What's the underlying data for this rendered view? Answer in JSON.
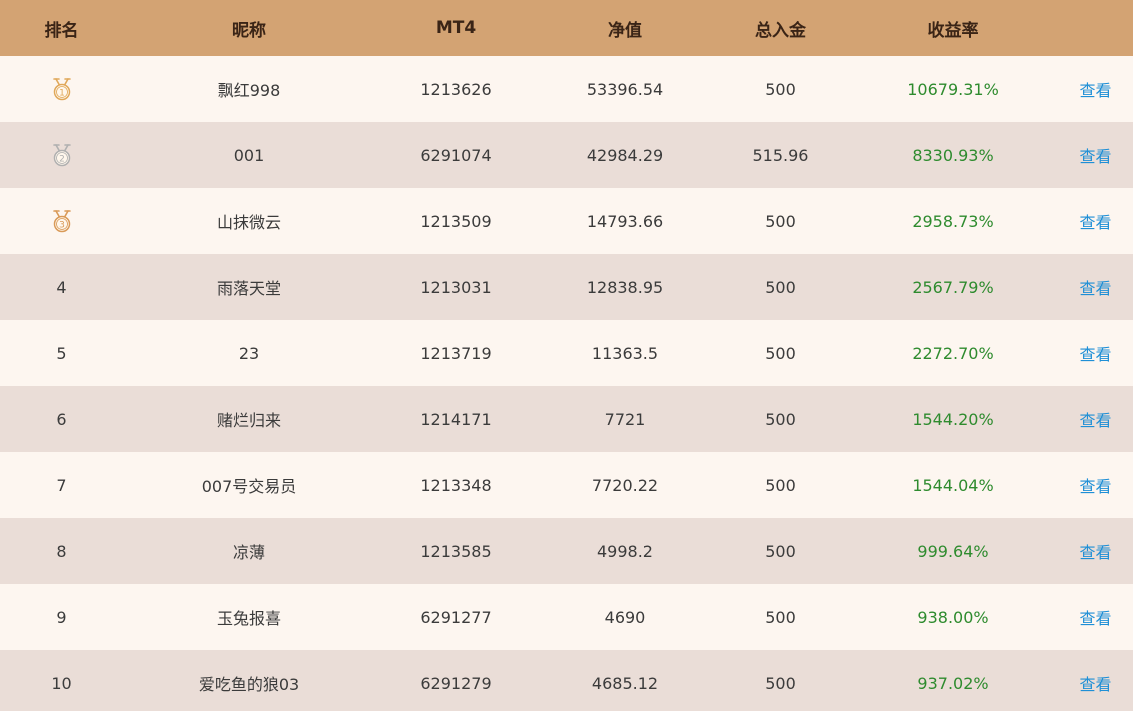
{
  "header": {
    "rank": "排名",
    "nickname": "昵称",
    "mt4": "MT4",
    "net_value": "净值",
    "total_deposit": "总入金",
    "return_rate": "收益率"
  },
  "colors": {
    "header_bg": "#d3a373",
    "row_light": "#fdf6f0",
    "row_dark": "#eaddd7",
    "rate_green": "#2e8b2e",
    "link_blue": "#1f8fd6",
    "gold_medal": "#e0a85a",
    "silver_medal": "#b0b0b0",
    "bronze_medal": "#d99a58"
  },
  "rows": [
    {
      "rank": "1",
      "medal": "gold-medal-icon",
      "nickname": "飘红998",
      "mt4": "1213626",
      "net_value": "53396.54",
      "total_deposit": "500",
      "return_rate": "10679.31%",
      "view": "查看"
    },
    {
      "rank": "2",
      "medal": "silver-medal-icon",
      "nickname": "001",
      "mt4": "6291074",
      "net_value": "42984.29",
      "total_deposit": "515.96",
      "return_rate": "8330.93%",
      "view": "查看"
    },
    {
      "rank": "3",
      "medal": "bronze-medal-icon",
      "nickname": "山抹微云",
      "mt4": "1213509",
      "net_value": "14793.66",
      "total_deposit": "500",
      "return_rate": "2958.73%",
      "view": "查看"
    },
    {
      "rank": "4",
      "nickname": "雨落天堂",
      "mt4": "1213031",
      "net_value": "12838.95",
      "total_deposit": "500",
      "return_rate": "2567.79%",
      "view": "查看"
    },
    {
      "rank": "5",
      "nickname": "23",
      "mt4": "1213719",
      "net_value": "11363.5",
      "total_deposit": "500",
      "return_rate": "2272.70%",
      "view": "查看"
    },
    {
      "rank": "6",
      "nickname": "赌烂归来",
      "mt4": "1214171",
      "net_value": "7721",
      "total_deposit": "500",
      "return_rate": "1544.20%",
      "view": "查看"
    },
    {
      "rank": "7",
      "nickname": "007号交易员",
      "mt4": "1213348",
      "net_value": "7720.22",
      "total_deposit": "500",
      "return_rate": "1544.04%",
      "view": "查看"
    },
    {
      "rank": "8",
      "nickname": "凉薄",
      "mt4": "1213585",
      "net_value": "4998.2",
      "total_deposit": "500",
      "return_rate": "999.64%",
      "view": "查看"
    },
    {
      "rank": "9",
      "nickname": "玉兔报喜",
      "mt4": "6291277",
      "net_value": "4690",
      "total_deposit": "500",
      "return_rate": "938.00%",
      "view": "查看"
    },
    {
      "rank": "10",
      "nickname": "爱吃鱼的狼03",
      "mt4": "6291279",
      "net_value": "4685.12",
      "total_deposit": "500",
      "return_rate": "937.02%",
      "view": "查看"
    }
  ]
}
